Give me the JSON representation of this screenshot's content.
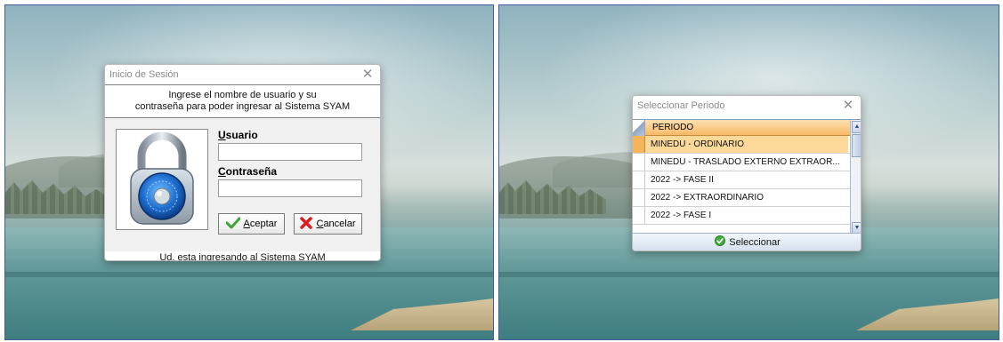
{
  "login": {
    "title": "Inicio de Sesión",
    "message_line1": "Ingrese el nombre de usuario y su",
    "message_line2": "contraseña para poder ingresar al Sistema SYAM",
    "user_label_first": "U",
    "user_label_rest": "suario",
    "user_value": "",
    "password_label_first": "C",
    "password_label_rest": "ontraseña",
    "password_value": "",
    "accept_first": "A",
    "accept_rest": "ceptar",
    "cancel_first": "C",
    "cancel_rest": "ancelar",
    "footer": "Ud. esta ingresando al Sistema SYAM",
    "icons": [
      "padlock-icon",
      "check-icon",
      "red-x-icon",
      "close-icon"
    ]
  },
  "period": {
    "title": "Seleccionar Periodo",
    "column_header": "PERIODO",
    "rows": [
      "MINEDU - ORDINARIO",
      "MINEDU - TRASLADO EXTERNO EXTRAOR...",
      "2022 -> FASE II",
      "2022 -> EXTRAORDINARIO",
      "2022 -> FASE I"
    ],
    "selected_index": 0,
    "select_button": "Seleccionar"
  },
  "colors": {
    "header_orange": "#f8b968",
    "selected_row": "#fcd999",
    "panel_border": "#3f5f9a"
  }
}
